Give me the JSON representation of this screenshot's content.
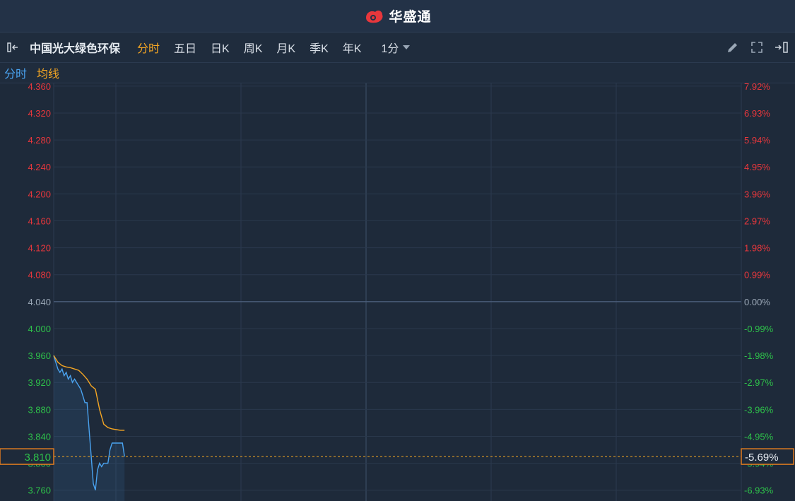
{
  "app": {
    "brand": "华盛通"
  },
  "toolbar": {
    "stock_name": "中国光大绿色环保",
    "periods": [
      "分时",
      "五日",
      "日K",
      "周K",
      "月K",
      "季K",
      "年K"
    ],
    "active_period": "分时",
    "interval": "1分"
  },
  "legend": {
    "series1": "分时",
    "series2": "均线"
  },
  "colors": {
    "up": "#e8373c",
    "down": "#2ec14a",
    "flat": "#9aa7b6",
    "price_line": "#4aa3f0",
    "avg_line": "#f5a623"
  },
  "chart_data": {
    "type": "line",
    "prev_close": 4.04,
    "current_price": 3.81,
    "current_change_pct": "-5.69%",
    "current_price_label": "3.810",
    "ylim": [
      3.744,
      4.364
    ],
    "y_ticks": [
      4.36,
      4.32,
      4.28,
      4.24,
      4.2,
      4.16,
      4.12,
      4.08,
      4.04,
      4.0,
      3.96,
      3.92,
      3.88,
      3.84,
      3.8,
      3.76
    ],
    "y_tick_labels": [
      "4.360",
      "4.320",
      "4.280",
      "4.240",
      "4.200",
      "4.160",
      "4.120",
      "4.080",
      "4.040",
      "4.000",
      "3.960",
      "3.920",
      "3.880",
      "3.840",
      "3.800",
      "3.760"
    ],
    "pct_labels": [
      "7.92%",
      "6.93%",
      "5.94%",
      "4.95%",
      "3.96%",
      "2.97%",
      "1.98%",
      "0.99%",
      "0.00%",
      "-0.99%",
      "-1.98%",
      "-2.97%",
      "-3.96%",
      "-4.95%",
      "-5.94%",
      "-6.93%"
    ],
    "session_minutes": 330,
    "series": [
      {
        "name": "分时",
        "x": [
          0,
          1,
          2,
          3,
          4,
          5,
          6,
          7,
          8,
          9,
          10,
          11,
          12,
          13,
          14,
          15,
          16,
          17,
          18,
          19,
          20,
          21,
          22,
          23,
          24,
          25,
          26,
          27,
          28,
          29,
          30,
          31,
          32,
          33,
          34
        ],
        "values": [
          3.96,
          3.95,
          3.94,
          3.935,
          3.94,
          3.93,
          3.935,
          3.925,
          3.93,
          3.92,
          3.925,
          3.92,
          3.915,
          3.91,
          3.9,
          3.89,
          3.89,
          3.85,
          3.81,
          3.77,
          3.76,
          3.79,
          3.8,
          3.795,
          3.8,
          3.8,
          3.8,
          3.82,
          3.83,
          3.83,
          3.83,
          3.83,
          3.83,
          3.83,
          3.81
        ]
      },
      {
        "name": "均线",
        "x": [
          0,
          2,
          4,
          6,
          8,
          10,
          12,
          14,
          16,
          18,
          20,
          22,
          24,
          26,
          28,
          30,
          32,
          34
        ],
        "values": [
          3.96,
          3.95,
          3.945,
          3.943,
          3.942,
          3.94,
          3.938,
          3.932,
          3.925,
          3.915,
          3.91,
          3.88,
          3.858,
          3.853,
          3.851,
          3.85,
          3.849,
          3.849
        ]
      }
    ]
  }
}
